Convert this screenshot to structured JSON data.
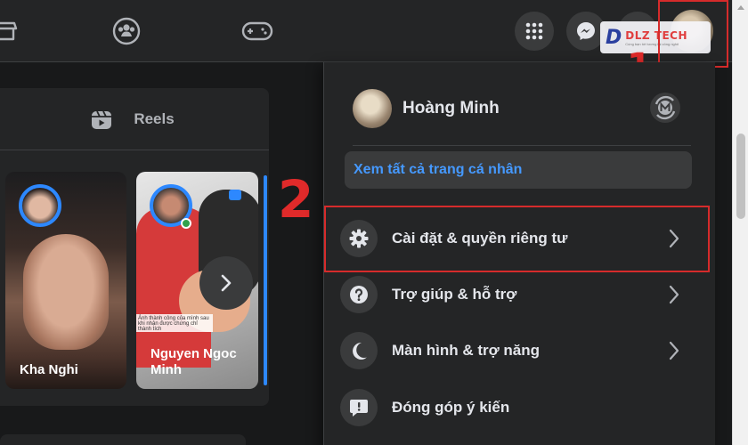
{
  "top_nav": {
    "icons": [
      "marketplace-icon",
      "groups-icon",
      "gaming-icon"
    ],
    "actions": [
      "menu-grid-icon",
      "messenger-icon",
      "notifications-icon",
      "account-avatar"
    ]
  },
  "watermark": {
    "logo_letter": "D",
    "brand": "DLZ TECH",
    "tagline": "Cùng bạn tới tương lai công nghệ"
  },
  "annotations": {
    "step_1": "1",
    "step_2": "2",
    "highlight_color": "#d62b2b"
  },
  "stories": {
    "reels_tab_label": "Reels",
    "items": [
      {
        "name": "Kha Nghi"
      },
      {
        "name": "Nguyen Ngoc Minh"
      }
    ],
    "caption_overlay": "Ảnh thành công của mình sau khi nhận được chứng chỉ thành tích"
  },
  "account_menu": {
    "profile_name": "Hoàng Minh",
    "see_all_profiles": "Xem tất cả trang cá nhân",
    "items": [
      {
        "label": "Cài đặt & quyền riêng tư",
        "icon": "gear-icon",
        "has_submenu": true
      },
      {
        "label": "Trợ giúp & hỗ trợ",
        "icon": "help-icon",
        "has_submenu": true
      },
      {
        "label": "Màn hình & trợ năng",
        "icon": "moon-icon",
        "has_submenu": true
      },
      {
        "label": "Đóng góp ý kiến",
        "icon": "feedback-icon",
        "has_submenu": false
      }
    ]
  },
  "colors": {
    "background": "#18191a",
    "surface": "#242526",
    "link_blue": "#4599ff",
    "story_ring": "#2d88ff"
  }
}
